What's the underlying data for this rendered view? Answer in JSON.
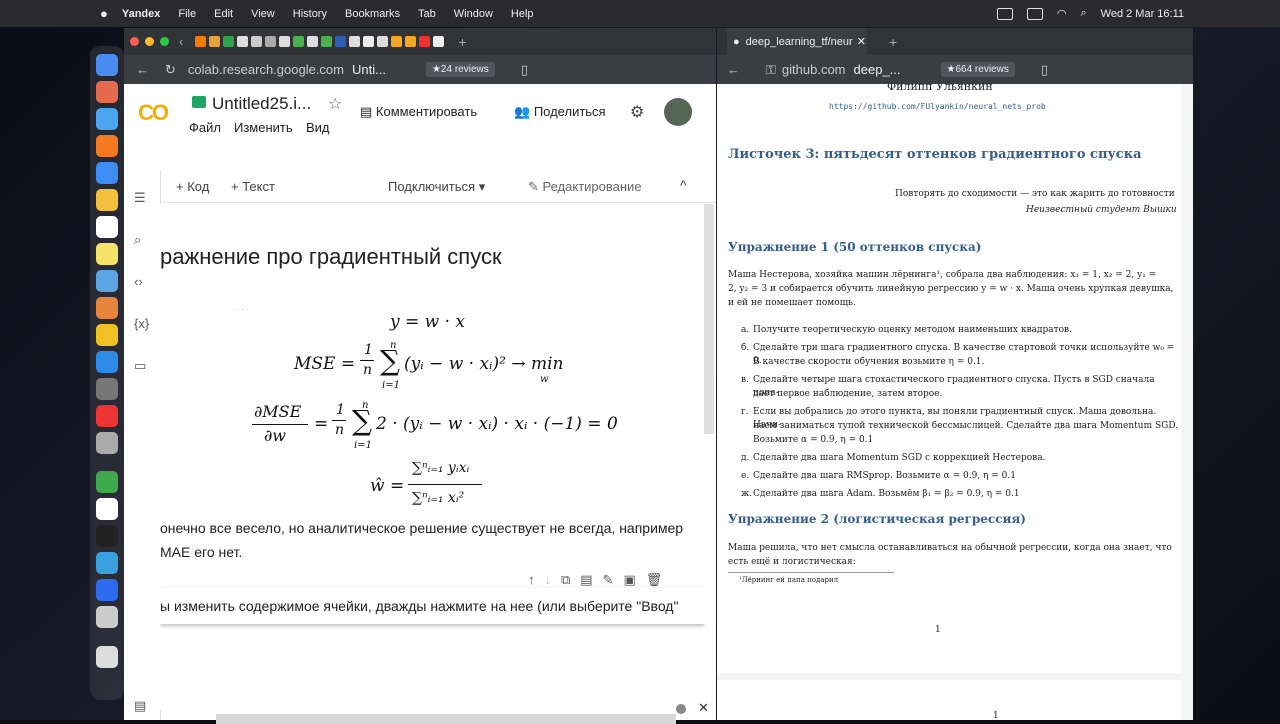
{
  "menubar": {
    "app": "Yandex",
    "items": [
      "File",
      "Edit",
      "View",
      "History",
      "Bookmarks",
      "Tab",
      "Window",
      "Help"
    ],
    "clock": "Wed 2 Mar  16:11"
  },
  "left_browser": {
    "url_domain": "colab.research.google.com",
    "url_title": "Unti...",
    "reviews": "★24 reviews"
  },
  "right_browser": {
    "tab_title": "deep_learning_tf/neur",
    "url_domain": "github.com",
    "url_title": "deep_...",
    "reviews": "★664 reviews"
  },
  "colab": {
    "title": "Untitled25.i...",
    "menu": [
      "Файл",
      "Изменить",
      "Вид"
    ],
    "comment_btn": "Комментировать",
    "share_btn": "Поделиться",
    "add_code": "+ Код",
    "add_text": "+ Текст",
    "connect": "Подключиться",
    "editing": "Редактирование",
    "heading": "ражнение про градиентный спуск",
    "faded_line": ". . .",
    "eq1": "y = w · x",
    "eq2_lhs": "MSE =",
    "eq2_sum_top": "n",
    "eq2_sum_bot": "i=1",
    "eq2_frac_top": "1",
    "eq2_frac_bot": "n",
    "eq2_body": "(yᵢ − w · xᵢ)² → min",
    "eq2_sub": "w",
    "eq3_num": "∂MSE",
    "eq3_den": "∂w",
    "eq3_eq": "=",
    "eq3_body": "2 · (yᵢ − w · xᵢ) · xᵢ · (−1) = 0",
    "eq4_lhs": "ŵ =",
    "eq4_num": "∑ⁿᵢ₌₁ yᵢxᵢ",
    "eq4_den": "∑ⁿᵢ₌₁ xᵢ²",
    "para1": "онечно все весело, но аналитическое решение существует не всегда, например",
    "para2": "MAE его нет.",
    "edit_hint": "ы изменить содержимое ячейки, дважды нажмите на нее (или выберите \"Ввод\""
  },
  "pdf": {
    "author": "Филипп Ульянкин",
    "link": "https://github.com/FUlyankin/neural_nets_prob",
    "title": "Листочек 3: пятьдесят оттенков градиентного спуска",
    "epigraph": "Повторять до сходимости — это как жарить до готовности",
    "epigraph_author": "Неизвестный студент Вышки",
    "ex1_title": "Упражнение 1 (50 оттенков спуска)",
    "ex1_text": [
      "Маша Нестерова, хозяйка машин лёрнинга¹, собрала два наблюдения: x₁ = 1, x₂ = 2, y₁ =",
      "2, y₂ = 3 и собирается обучить линейную регрессию y = w · x. Маша очень хрупкая девушка,",
      "и ей не помешает помощь."
    ],
    "items": [
      {
        "m": "а.",
        "lines": [
          "Получите теоретическую оценку методом наименьших квадратов."
        ]
      },
      {
        "m": "б.",
        "lines": [
          "Сделайте три шага градиентного спуска. В качестве стартовой точки используйте w₀ = 0.",
          "В качестве скорости обучения возьмите η = 0.1."
        ]
      },
      {
        "m": "в.",
        "lines": [
          "Сделайте четыре шага стохастического градиентного спуска. Пусть в SGD сначала попа-",
          "дает первое наблюдение, затем второе."
        ]
      },
      {
        "m": "г.",
        "lines": [
          "Если вы добрались до этого пункта, вы поняли градиентный спуск. Маша довольна. Начи-",
          "наем заниматься тупой технической бессмыслицей. Сделайте два шага Momentum SGD.",
          "Возьмите α = 0.9, η = 0.1"
        ]
      },
      {
        "m": "д.",
        "lines": [
          "Сделайте два шага Momentum SGD с коррекцией Нестерова."
        ]
      },
      {
        "m": "е.",
        "lines": [
          "Сделайте два шага RMSprop. Возьмите α = 0.9, η = 0.1"
        ]
      },
      {
        "m": "ж.",
        "lines": [
          "Сделайте два шага Adam. Возьмём β₁ = β₂ = 0.9, η = 0.1"
        ]
      }
    ],
    "ex2_title": "Упражнение 2 (логистическая регрессия)",
    "ex2_text": [
      "Маша решила, что нет смысла останавливаться на обычной регрессии, когда она знает, что",
      "есть ещё и логистическая:"
    ],
    "footnote": "¹Лёрнинг ей папа подарил",
    "page_num": "1",
    "next_page_frag": "1"
  }
}
